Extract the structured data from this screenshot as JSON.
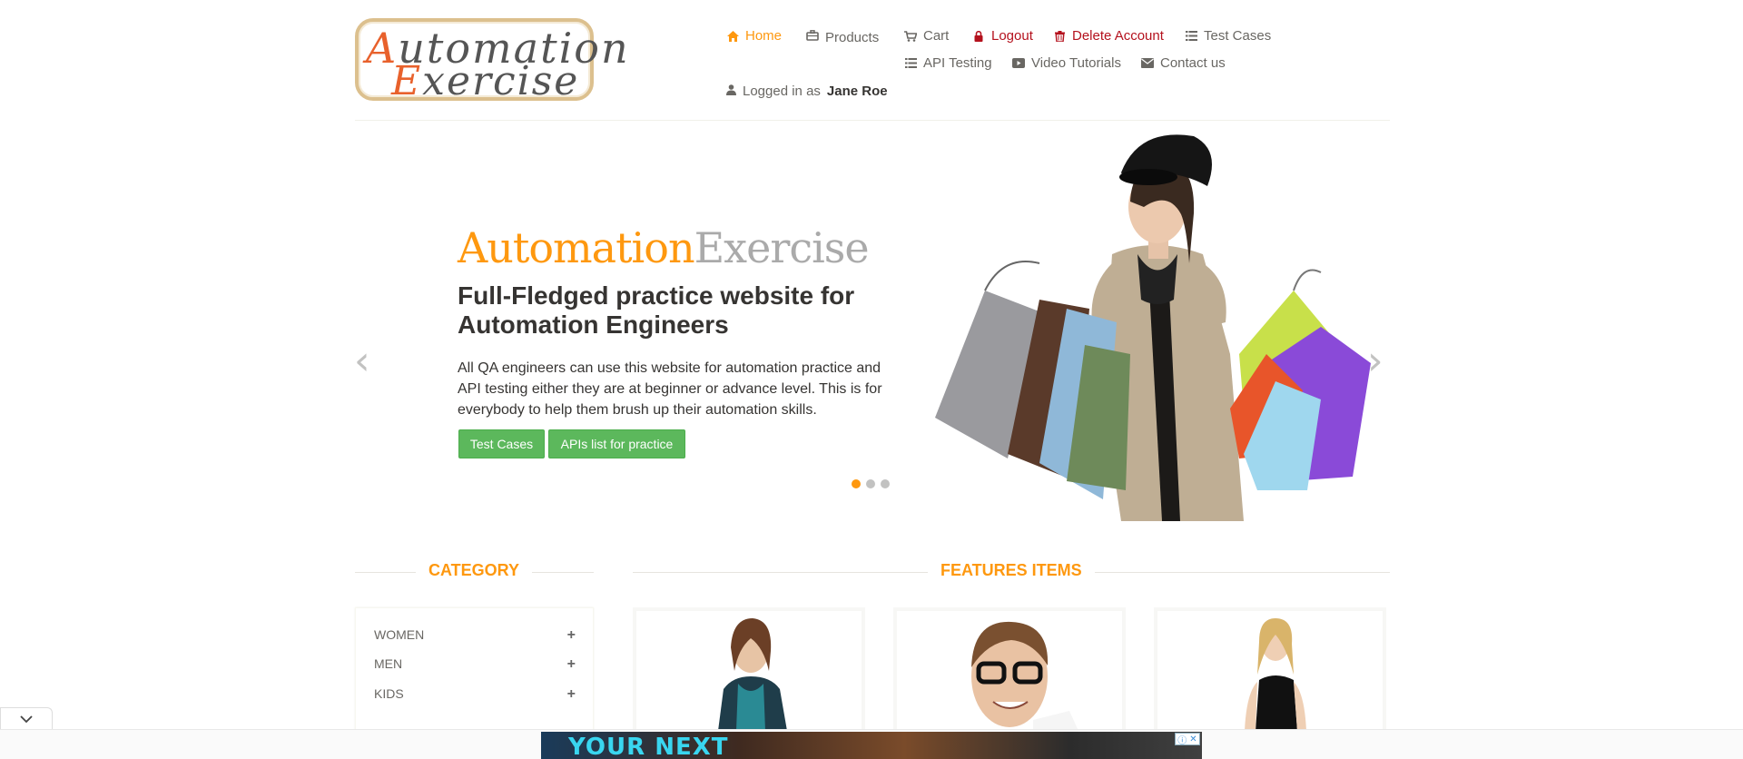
{
  "brand": {
    "logo_line1_cap": "A",
    "logo_line1_rest": "utomation",
    "logo_line2_cap": "E",
    "logo_line2_rest": "xercise"
  },
  "nav": {
    "home": "Home",
    "products": "Products",
    "cart": "Cart",
    "logout": "Logout",
    "delete_account": "Delete Account",
    "test_cases": "Test Cases",
    "api_testing": "API Testing",
    "video_tutorials": "Video Tutorials",
    "contact_us": "Contact us",
    "logged_in_prefix": "Logged in as",
    "logged_in_user": "Jane Roe"
  },
  "slider": {
    "brand_orange": "Automation",
    "brand_gray": "Exercise",
    "heading": "Full-Fledged practice website for Automation Engineers",
    "description": "All QA engineers can use this website for automation practice and API testing either they are at beginner or advance level. This is for everybody to help them brush up their automation skills.",
    "btn_test_cases": "Test Cases",
    "btn_apis": "APIs list for practice",
    "prev_arrow": "‹",
    "next_arrow": "›",
    "active_slide": 1,
    "slide_count": 3
  },
  "sidebar": {
    "title": "CATEGORY",
    "items": [
      {
        "label": "WOMEN",
        "toggle": "+"
      },
      {
        "label": "MEN",
        "toggle": "+"
      },
      {
        "label": "KIDS",
        "toggle": "+"
      }
    ]
  },
  "features": {
    "title": "FEATURES ITEMS"
  },
  "ad": {
    "text": "YOUR NEXT",
    "info_icon": "info-icon",
    "close_icon": "close-icon"
  },
  "colors": {
    "accent": "#fe980f",
    "danger": "#b4111d",
    "button_green": "#5cb85c",
    "logo_border": "#dcc08e",
    "logo_letter": "#e8612c"
  }
}
